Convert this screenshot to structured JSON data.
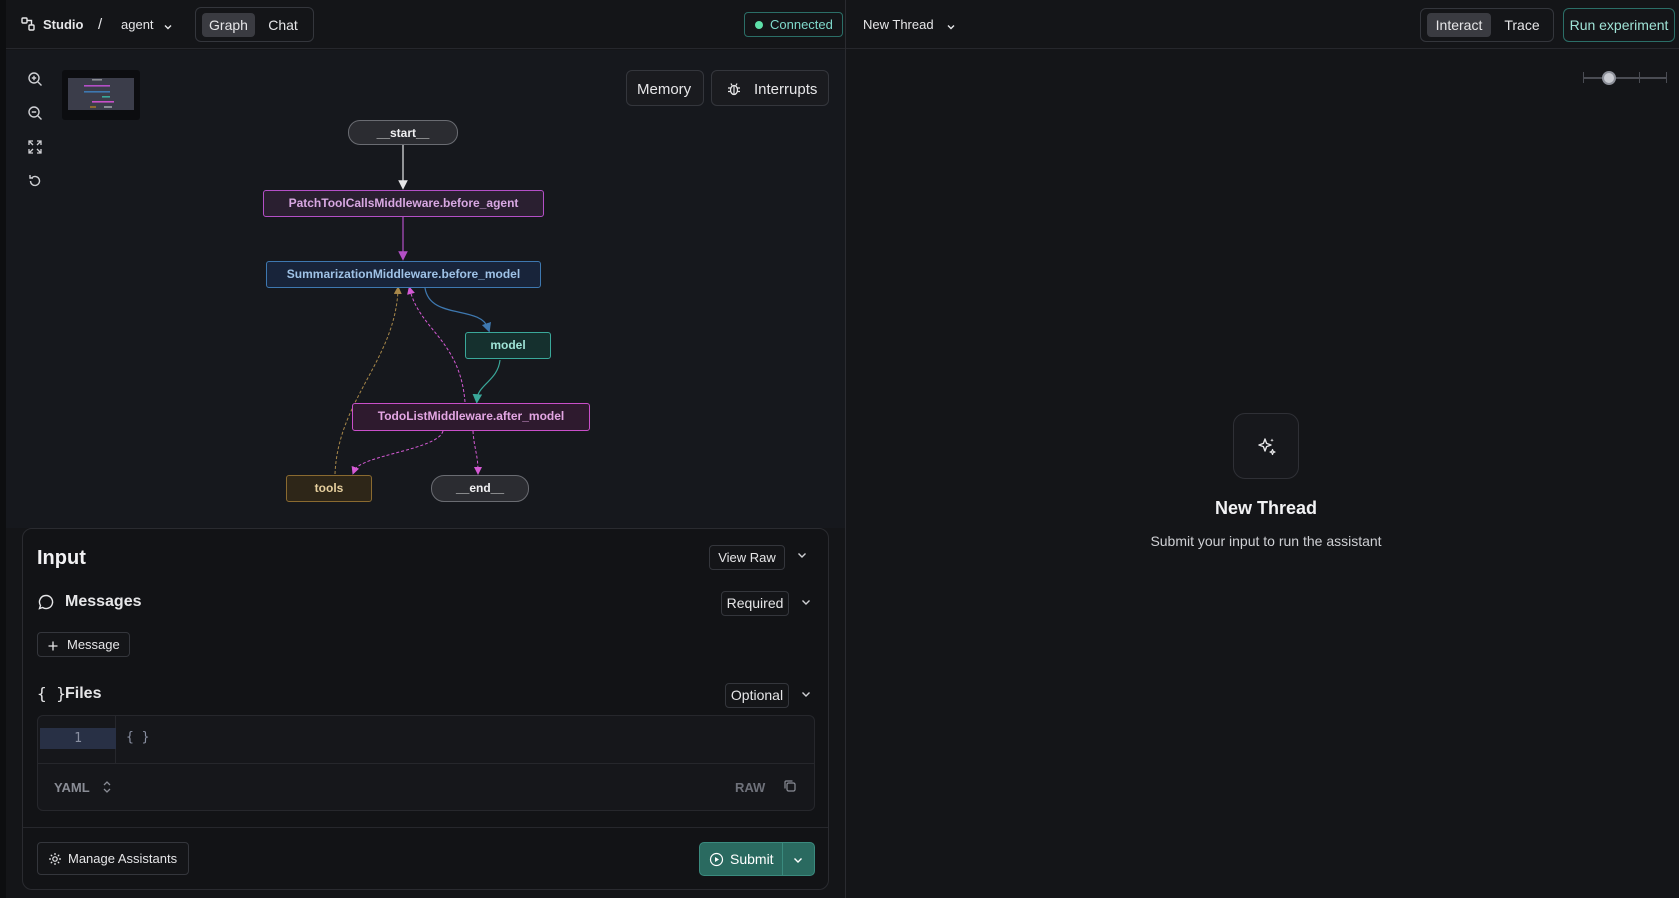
{
  "header": {
    "app_name": "Studio",
    "separator": "/",
    "graph_selector": "agent",
    "view_tabs": [
      "Graph",
      "Chat"
    ],
    "active_view": "Graph",
    "status": "Connected"
  },
  "graph": {
    "buttons": {
      "memory": "Memory",
      "interrupts": "Interrupts"
    },
    "controls": [
      "zoom-in-icon",
      "zoom-out-icon",
      "fit-view-icon",
      "reset-icon"
    ],
    "nodes": {
      "start": "__start__",
      "patch": "PatchToolCallsMiddleware.before_agent",
      "summarization": "SummarizationMiddleware.before_model",
      "model": "model",
      "todolist": "TodoListMiddleware.after_model",
      "tools": "tools",
      "end": "__end__"
    }
  },
  "input": {
    "title": "Input",
    "view_raw": "View Raw",
    "messages": {
      "label": "Messages",
      "badge": "Required",
      "add_button": "Message"
    },
    "files": {
      "label": "Files",
      "badge": "Optional",
      "line_number": "1",
      "code": "{ }",
      "format": "YAML",
      "raw": "RAW"
    },
    "manage_assistants": "Manage Assistants",
    "submit": "Submit"
  },
  "thread": {
    "selector": "New Thread",
    "mode_tabs": [
      "Interact",
      "Trace"
    ],
    "active_mode": "Interact",
    "run_experiment": "Run experiment",
    "empty_title": "New Thread",
    "empty_subtitle": "Submit your input to run the assistant"
  },
  "colors": {
    "accent_teal": "#2a6a60",
    "connected_green": "#5ee0a9",
    "node_purple": "#b44fc7",
    "node_blue": "#3e78b0",
    "node_teal": "#3aa89a",
    "node_pink": "#c94fc9",
    "node_amber": "#8a6a30"
  }
}
